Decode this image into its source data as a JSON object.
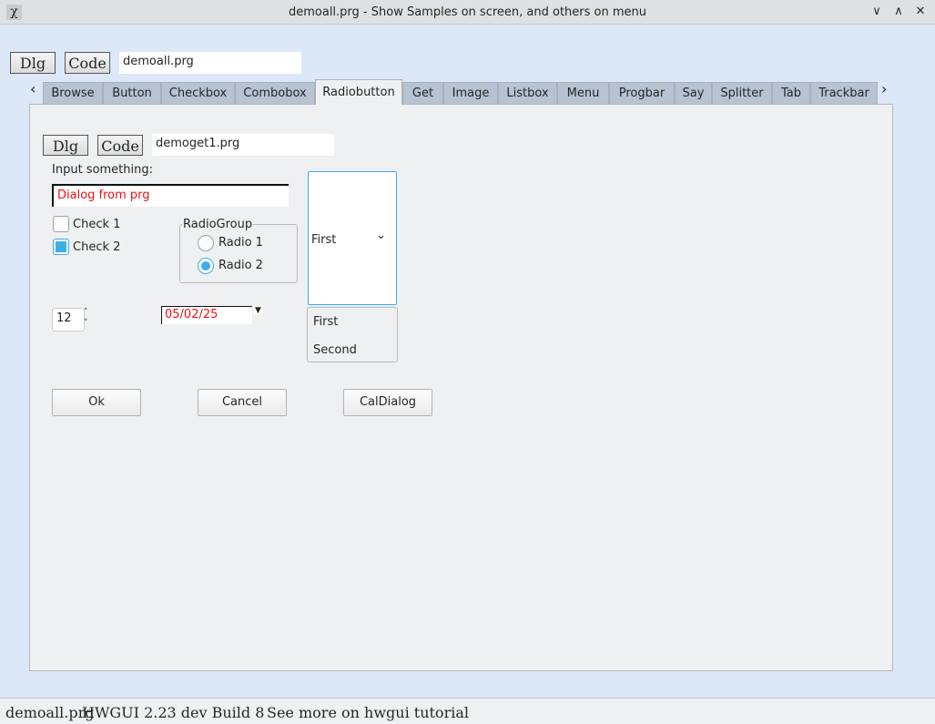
{
  "window": {
    "title": "demoall.prg - Show Samples on screen, and others on menu",
    "min": "∨",
    "max": "∧",
    "close": "✕"
  },
  "top": {
    "dlg": "Dlg",
    "code": "Code",
    "file": "demoall.prg"
  },
  "tabs": [
    "Browse",
    "Button",
    "Checkbox",
    "Combobox",
    "Radiobutton",
    "Get",
    "Image",
    "Listbox",
    "Menu",
    "Progbar",
    "Say",
    "Splitter",
    "Tab",
    "Trackbar"
  ],
  "tab_scroll": {
    "left": "‹",
    "right": "›"
  },
  "panel": {
    "dlg": "Dlg",
    "code": "Code",
    "file": "demoget1.prg",
    "input_label": "Input something:",
    "input_value": "Dialog from prg",
    "check1": "Check 1",
    "check2": "Check 2",
    "radio_group": "RadioGroup",
    "radio1": "Radio 1",
    "radio2": "Radio 2",
    "combo_value": "First",
    "list": [
      "First",
      "Second"
    ],
    "spin_value": "12",
    "date_value": "05/02/25",
    "ok": "Ok",
    "cancel": "Cancel",
    "caldialog": "CalDialog"
  },
  "status": {
    "file": "demoall.prg",
    "version": "HWGUI 2.23 dev Build 8",
    "more": "See more on hwgui tutorial"
  }
}
